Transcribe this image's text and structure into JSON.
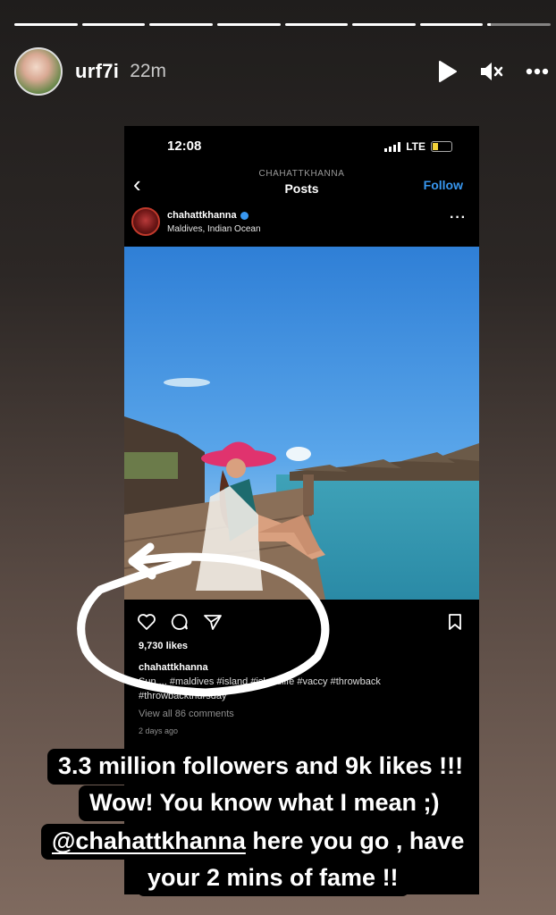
{
  "story": {
    "progress": [
      1,
      1,
      1,
      1,
      1,
      1,
      1,
      0.05
    ],
    "username": "urf7i",
    "time": "22m",
    "icons": [
      "play-icon",
      "mute-icon",
      "more-icon"
    ]
  },
  "screenshot": {
    "status_time": "12:08",
    "network": "LTE",
    "nav_account": "CHAHATTKHANNA",
    "nav_title": "Posts",
    "follow_label": "Follow",
    "post_user": "chahattkhanna",
    "post_location": "Maldives, Indian Ocean",
    "likes": "9,730 likes",
    "caption_user": "chahattkhanna",
    "caption_text": "Sun ... #maldives #island #islandlife #vaccy #throwback #throwbackthursday",
    "comments_link": "View all 86 comments",
    "posted_ago": "2 days ago"
  },
  "captions": {
    "line1": "3.3 million followers and 9k likes !!!",
    "line2": "Wow! You know what I mean ;)",
    "line3_mention": "@chahattkhanna",
    "line3_rest": " here you go , have",
    "line4": "your 2 mins of fame !!"
  }
}
